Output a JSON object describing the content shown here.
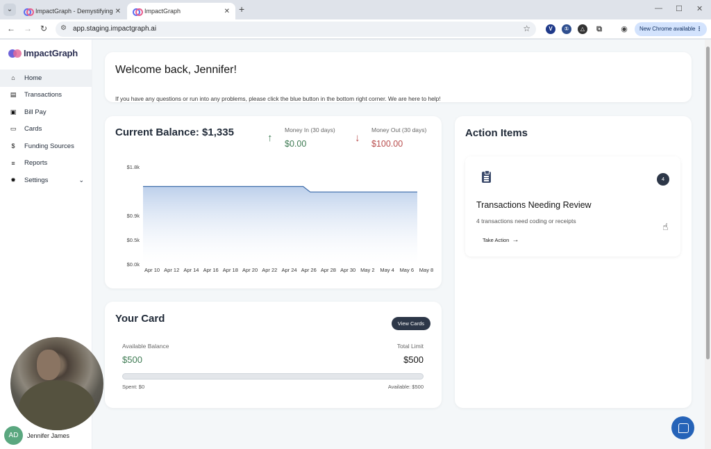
{
  "browser": {
    "tabs": [
      {
        "title": "ImpactGraph - Demystifying Fu",
        "active": false
      },
      {
        "title": "ImpactGraph",
        "active": true
      }
    ],
    "url": "app.staging.impactgraph.ai",
    "new_chrome_label": "New Chrome available"
  },
  "sidebar": {
    "logo": "ImpactGraph",
    "items": [
      {
        "label": "Home",
        "icon": "home-icon",
        "active": true
      },
      {
        "label": "Transactions",
        "icon": "receipt-icon"
      },
      {
        "label": "Bill Pay",
        "icon": "bill-icon"
      },
      {
        "label": "Cards",
        "icon": "card-icon"
      },
      {
        "label": "Funding Sources",
        "icon": "money-icon"
      },
      {
        "label": "Reports",
        "icon": "reports-icon"
      },
      {
        "label": "Settings",
        "icon": "gear-icon",
        "expandable": true
      }
    ],
    "user": {
      "initials": "AD",
      "name": "Jennifer James"
    }
  },
  "welcome": {
    "title": "Welcome back, Jennifer!",
    "subtitle": "If you have any questions or run into any problems, please click the blue button in the bottom right corner. We are here to help!"
  },
  "balance": {
    "title": "Current Balance: $1,335",
    "money_in_label": "Money In (30 days)",
    "money_in_value": "$0.00",
    "money_out_label": "Money Out (30 days)",
    "money_out_value": "$100.00",
    "colors": {
      "in": "#3d7a52",
      "out": "#b84c4c",
      "line": "#3b6aa8"
    }
  },
  "chart_data": {
    "type": "area",
    "title": "",
    "xlabel": "",
    "ylabel": "",
    "y_ticks": [
      "$1.8k",
      "$0.9k",
      "$0.5k",
      "$0.0k"
    ],
    "y_tick_values": [
      1800,
      900,
      500,
      0
    ],
    "categories": [
      "Apr 10",
      "Apr 12",
      "Apr 14",
      "Apr 16",
      "Apr 18",
      "Apr 20",
      "Apr 22",
      "Apr 24",
      "Apr 26",
      "Apr 28",
      "Apr 30",
      "May 2",
      "May 4",
      "May 6",
      "May 8"
    ],
    "series": [
      {
        "values": [
          1435,
          1435,
          1435,
          1435,
          1435,
          1435,
          1435,
          1435,
          1435,
          1335,
          1335,
          1335,
          1335,
          1335,
          1335
        ]
      }
    ],
    "grid": false,
    "legend": "none"
  },
  "your_card": {
    "title": "Your Card",
    "view_cards_label": "View Cards",
    "available_balance_label": "Available Balance",
    "available_balance_value": "$500",
    "total_limit_label": "Total Limit",
    "total_limit_value": "$500",
    "spent_label": "Spent: $0",
    "available_label": "Available: $500",
    "spent_fraction": 0
  },
  "action_items": {
    "title": "Action Items",
    "items": [
      {
        "count": "4",
        "title": "Transactions Needing Review",
        "description": "4 transactions need coding or receipts",
        "action_label": "Take Action"
      }
    ]
  }
}
